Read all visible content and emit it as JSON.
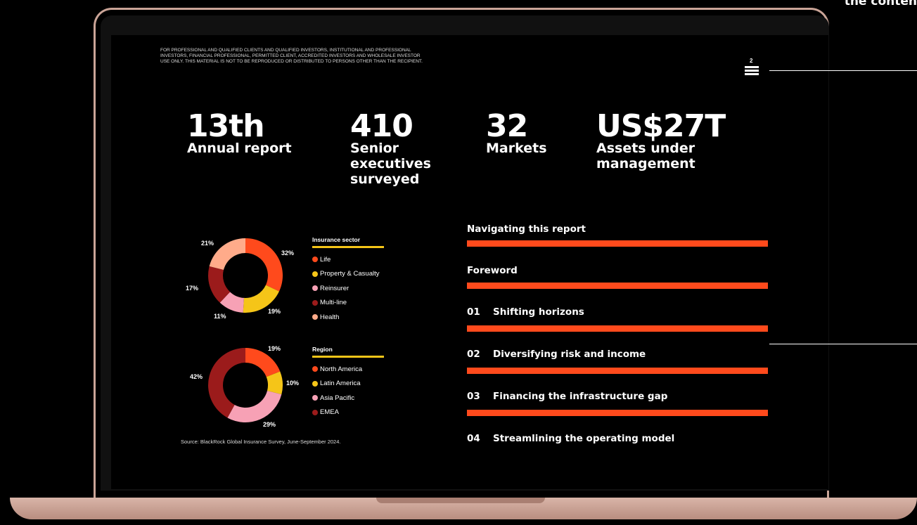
{
  "corner_text": "the conten",
  "disclaimer": "For professional and qualified clients and qualified investors, institutional and professional investors, financial professional, permitted client, accredited investors and wholesale investor use only. This material is not to be reproduced or distributed to persons other than the recipient.",
  "page_number": "2",
  "stats": [
    {
      "value": "13th",
      "label": "Annual report"
    },
    {
      "value": "410",
      "label": "Senior executives surveyed"
    },
    {
      "value": "32",
      "label": "Markets"
    },
    {
      "value": "US$27T",
      "label": "Assets under management"
    }
  ],
  "charts": [
    {
      "title": "Insurance sector",
      "slices": [
        {
          "name": "Life",
          "value": 32,
          "label": "32%",
          "color": "#ff4a1c"
        },
        {
          "name": "Property & Casualty",
          "value": 19,
          "label": "19%",
          "color": "#f5c518"
        },
        {
          "name": "Reinsurer",
          "value": 11,
          "label": "11%",
          "color": "#f7a1b5"
        },
        {
          "name": "Multi-line",
          "value": 17,
          "label": "17%",
          "color": "#9b1b1b"
        },
        {
          "name": "Health",
          "value": 21,
          "label": "21%",
          "color": "#ffab8a"
        }
      ]
    },
    {
      "title": "Region",
      "slices": [
        {
          "name": "North America",
          "value": 19,
          "label": "19%",
          "color": "#ff4a1c"
        },
        {
          "name": "Latin America",
          "value": 10,
          "label": "10%",
          "color": "#f5c518"
        },
        {
          "name": "Asia Pacific",
          "value": 29,
          "label": "29%",
          "color": "#f7a1b5"
        },
        {
          "name": "EMEA",
          "value": 42,
          "label": "42%",
          "color": "#9b1b1b"
        }
      ]
    }
  ],
  "source": "Source: BlackRock Global Insurance Survey, June-September 2024.",
  "nav": [
    {
      "num": "",
      "label": "Navigating this report"
    },
    {
      "num": "",
      "label": "Foreword"
    },
    {
      "num": "01",
      "label": "Shifting horizons"
    },
    {
      "num": "02",
      "label": "Diversifying risk and income"
    },
    {
      "num": "03",
      "label": "Financing the infrastructure gap"
    },
    {
      "num": "04",
      "label": "Streamlining the operating model"
    }
  ],
  "colors": {
    "accent": "#ff4a1c",
    "legend_rule": "#f5c518",
    "bezel": "#caa497"
  }
}
